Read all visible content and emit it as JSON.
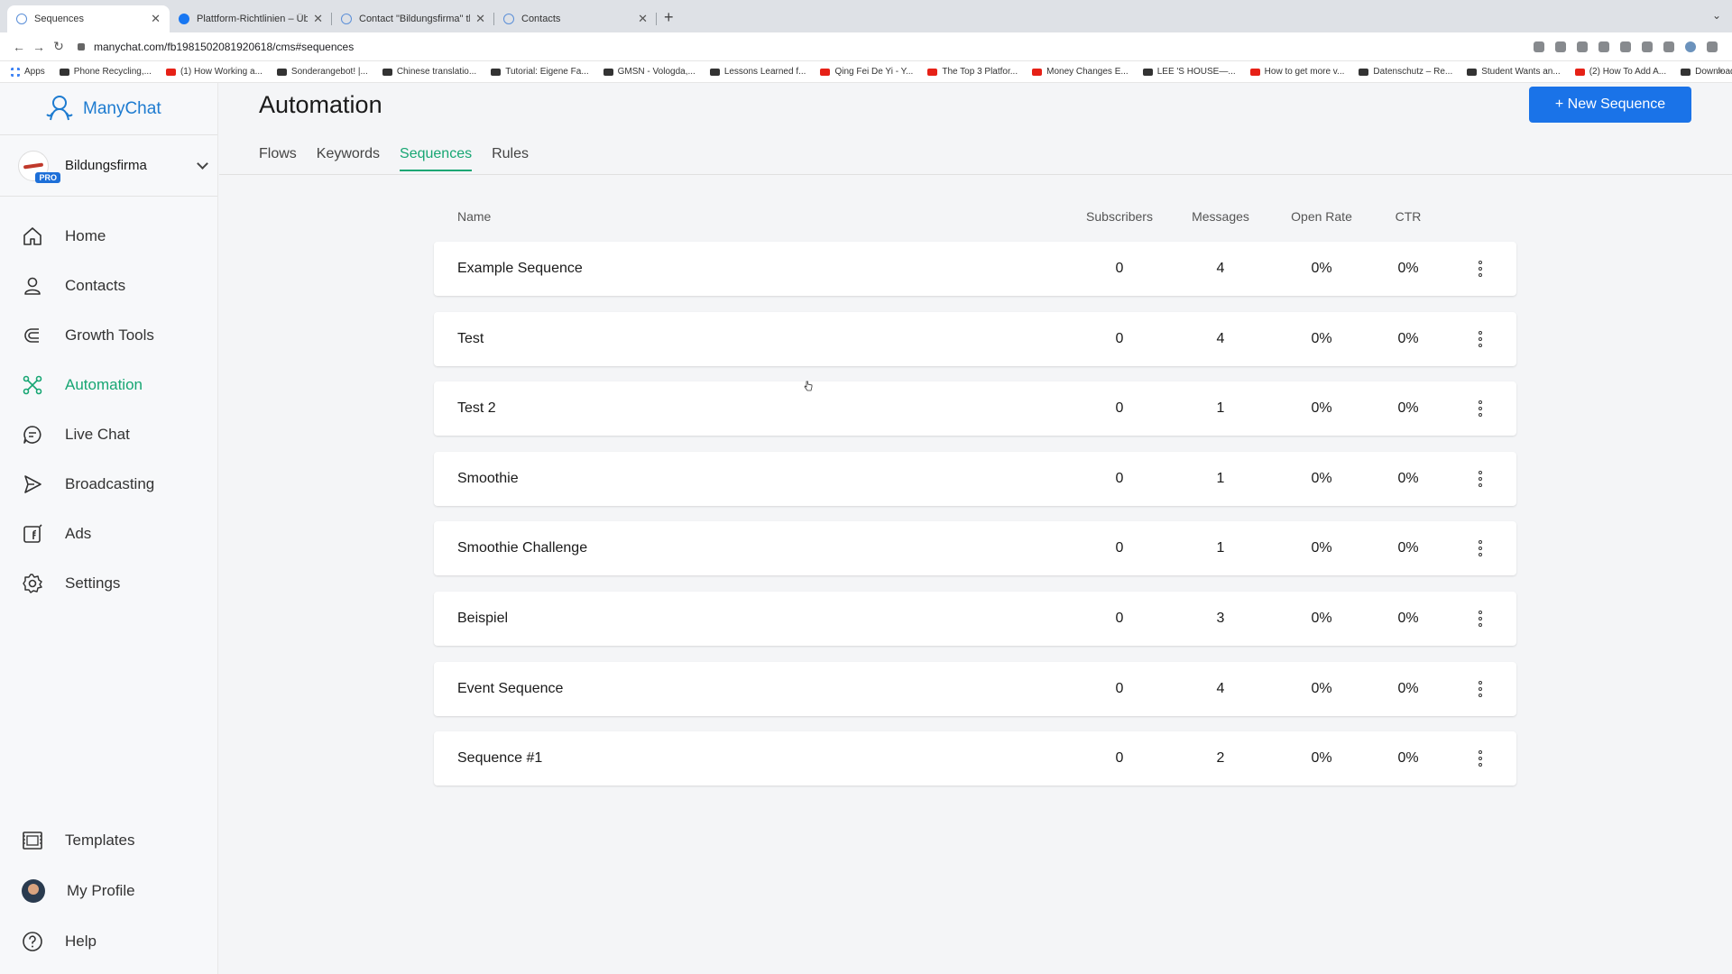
{
  "browser": {
    "tabs": [
      {
        "label": "Sequences",
        "favicon": "manychat-icon",
        "active": true
      },
      {
        "label": "Plattform-Richtlinien – Übersic",
        "favicon": "facebook-icon",
        "active": false
      },
      {
        "label": "Contact \"Bildungsfirma\" throu",
        "favicon": "manychat-icon",
        "active": false
      },
      {
        "label": "Contacts",
        "favicon": "manychat-icon",
        "active": false
      }
    ],
    "url": "manychat.com/fb1981502081920618/cms#sequences",
    "bookmarks": [
      {
        "label": "Apps",
        "icon": "apps-icon"
      },
      {
        "label": "Phone Recycling,...",
        "icon": "search-icon"
      },
      {
        "label": "(1) How Working a...",
        "icon": "youtube-icon"
      },
      {
        "label": "Sonderangebot! |...",
        "icon": "site-icon"
      },
      {
        "label": "Chinese translatio...",
        "icon": "site-icon"
      },
      {
        "label": "Tutorial: Eigene Fa...",
        "icon": "hash-icon"
      },
      {
        "label": "GMSN - Vologda,...",
        "icon": "site-icon"
      },
      {
        "label": "Lessons Learned f...",
        "icon": "site-icon"
      },
      {
        "label": "Qing Fei De Yi - Y...",
        "icon": "youtube-icon"
      },
      {
        "label": "The Top 3 Platfor...",
        "icon": "youtube-icon"
      },
      {
        "label": "Money Changes E...",
        "icon": "youtube-icon"
      },
      {
        "label": "LEE 'S HOUSE—...",
        "icon": "airbnb-icon"
      },
      {
        "label": "How to get more v...",
        "icon": "youtube-icon"
      },
      {
        "label": "Datenschutz – Re...",
        "icon": "site-icon"
      },
      {
        "label": "Student Wants an...",
        "icon": "site-icon"
      },
      {
        "label": "(2) How To Add A...",
        "icon": "youtube-icon"
      },
      {
        "label": "Download - Cooki...",
        "icon": "site-icon"
      }
    ]
  },
  "sidebar": {
    "brand": "ManyChat",
    "account_name": "Bildungsfirma",
    "account_badge": "PRO",
    "items": [
      {
        "label": "Home",
        "icon": "home-icon",
        "active": false
      },
      {
        "label": "Contacts",
        "icon": "user-icon",
        "active": false
      },
      {
        "label": "Growth Tools",
        "icon": "magnet-icon",
        "active": false
      },
      {
        "label": "Automation",
        "icon": "automation-icon",
        "active": true
      },
      {
        "label": "Live Chat",
        "icon": "chat-icon",
        "active": false
      },
      {
        "label": "Broadcasting",
        "icon": "send-icon",
        "active": false
      },
      {
        "label": "Ads",
        "icon": "facebook-ads-icon",
        "active": false
      },
      {
        "label": "Settings",
        "icon": "gear-icon",
        "active": false
      }
    ],
    "bottom_items": [
      {
        "label": "Templates",
        "icon": "templates-icon"
      },
      {
        "label": "My Profile",
        "icon": "avatar"
      },
      {
        "label": "Help",
        "icon": "help-icon"
      }
    ]
  },
  "main": {
    "title": "Automation",
    "new_button": "+ New Sequence",
    "tabs": [
      {
        "label": "Flows",
        "active": false
      },
      {
        "label": "Keywords",
        "active": false
      },
      {
        "label": "Sequences",
        "active": true
      },
      {
        "label": "Rules",
        "active": false
      }
    ],
    "table": {
      "columns": [
        "Name",
        "Subscribers",
        "Messages",
        "Open Rate",
        "CTR"
      ],
      "rows": [
        {
          "name": "Example Sequence",
          "subscribers": "0",
          "messages": "4",
          "open_rate": "0%",
          "ctr": "0%"
        },
        {
          "name": "Test",
          "subscribers": "0",
          "messages": "4",
          "open_rate": "0%",
          "ctr": "0%"
        },
        {
          "name": "Test 2",
          "subscribers": "0",
          "messages": "1",
          "open_rate": "0%",
          "ctr": "0%"
        },
        {
          "name": "Smoothie",
          "subscribers": "0",
          "messages": "1",
          "open_rate": "0%",
          "ctr": "0%"
        },
        {
          "name": "Smoothie Challenge",
          "subscribers": "0",
          "messages": "1",
          "open_rate": "0%",
          "ctr": "0%"
        },
        {
          "name": "Beispiel",
          "subscribers": "0",
          "messages": "3",
          "open_rate": "0%",
          "ctr": "0%"
        },
        {
          "name": "Event Sequence",
          "subscribers": "0",
          "messages": "4",
          "open_rate": "0%",
          "ctr": "0%"
        },
        {
          "name": "Sequence #1",
          "subscribers": "0",
          "messages": "2",
          "open_rate": "0%",
          "ctr": "0%"
        }
      ]
    }
  },
  "colors": {
    "accent_green": "#17a673",
    "primary_blue": "#1a73e8",
    "brand_blue": "#1d7bd0"
  }
}
